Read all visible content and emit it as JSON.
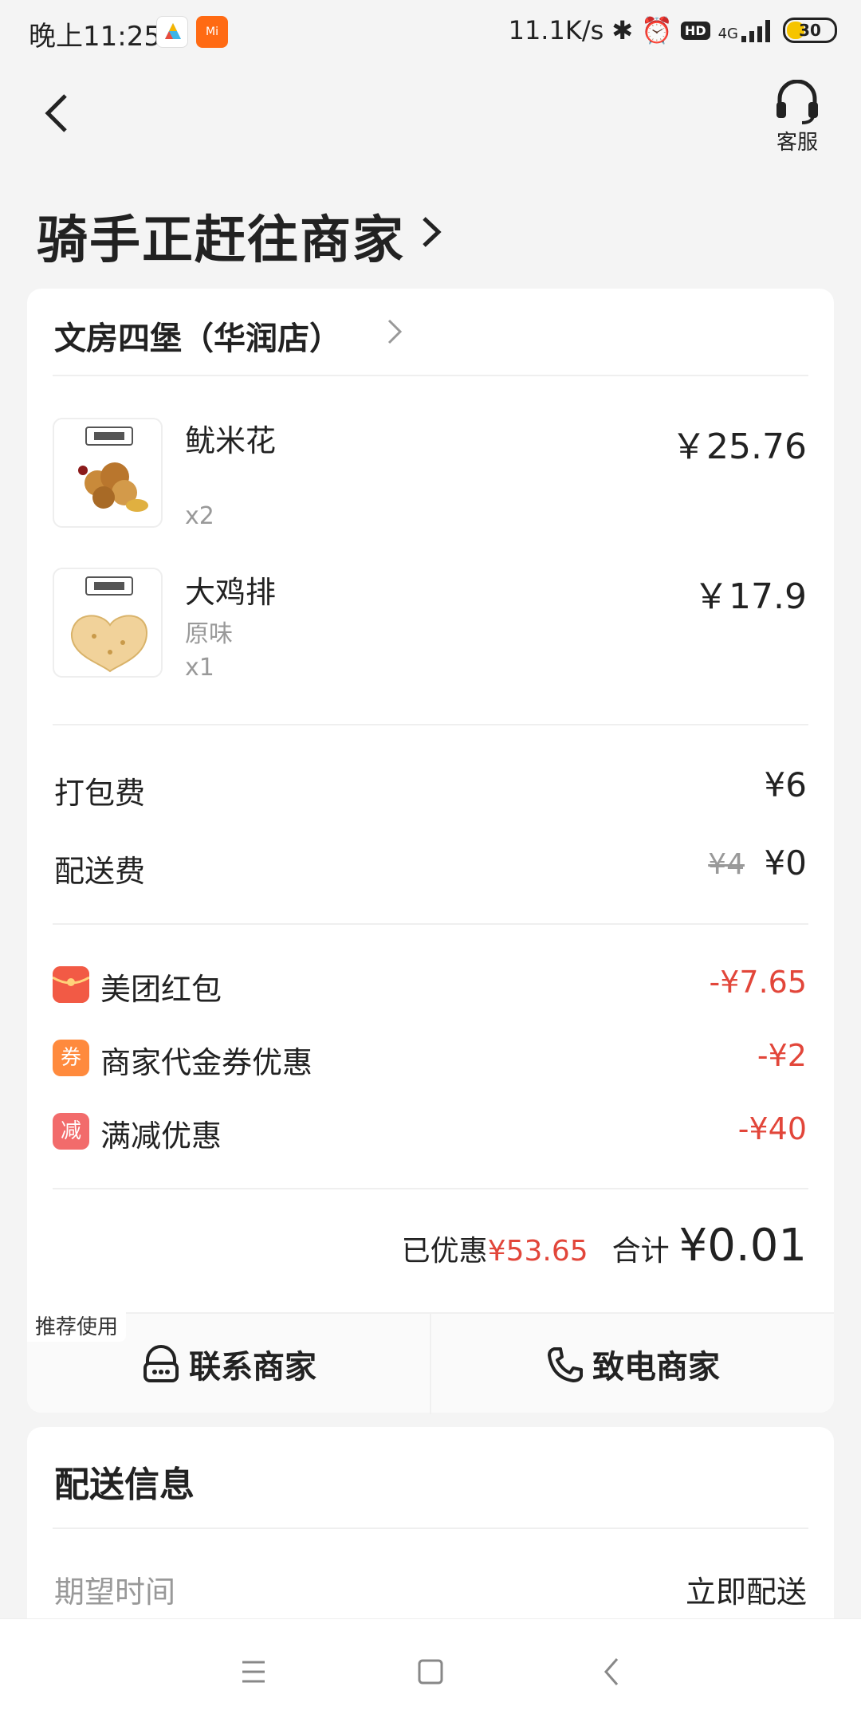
{
  "status_bar": {
    "time": "晚上11:25",
    "app_badge": "Mi",
    "net_speed": "11.1K/s",
    "hd": "HD",
    "signal": "4G",
    "battery": "30"
  },
  "header": {
    "customer_service_label": "客服",
    "title": "骑手正赶往商家"
  },
  "order": {
    "shop_name": "文房四堡（华润店）",
    "items": [
      {
        "name": "鱿米花",
        "option": "",
        "qty": "x2",
        "price": "￥25.76"
      },
      {
        "name": "大鸡排",
        "option": "原味",
        "qty": "x1",
        "price": "￥17.9"
      }
    ],
    "packing_label": "打包费",
    "packing_fee": "¥6",
    "delivery_label": "配送费",
    "delivery_original": "¥4",
    "delivery_fee": "¥0",
    "discounts": [
      {
        "icon": "红",
        "icon_color": "#f25a45",
        "label": "美团红包",
        "value": "-¥7.65"
      },
      {
        "icon": "券",
        "icon_color": "#ff8a3d",
        "label": "商家代金券优惠",
        "value": "-¥2"
      },
      {
        "icon": "减",
        "icon_color": "#f26b6b",
        "label": "满减优惠",
        "value": "-¥40"
      }
    ],
    "saved_label": "已优惠",
    "saved_value": "¥53.65",
    "total_label": "合计",
    "total_value": "¥0.01",
    "recommend_tag": "推荐使用",
    "contact_label": "联系商家",
    "call_label": "致电商家"
  },
  "delivery_info": {
    "title": "配送信息",
    "expected_label": "期望时间",
    "expected_value": "立即配送"
  },
  "colors": {
    "accent_red": "#e2463a",
    "background": "#f4f4f4"
  }
}
